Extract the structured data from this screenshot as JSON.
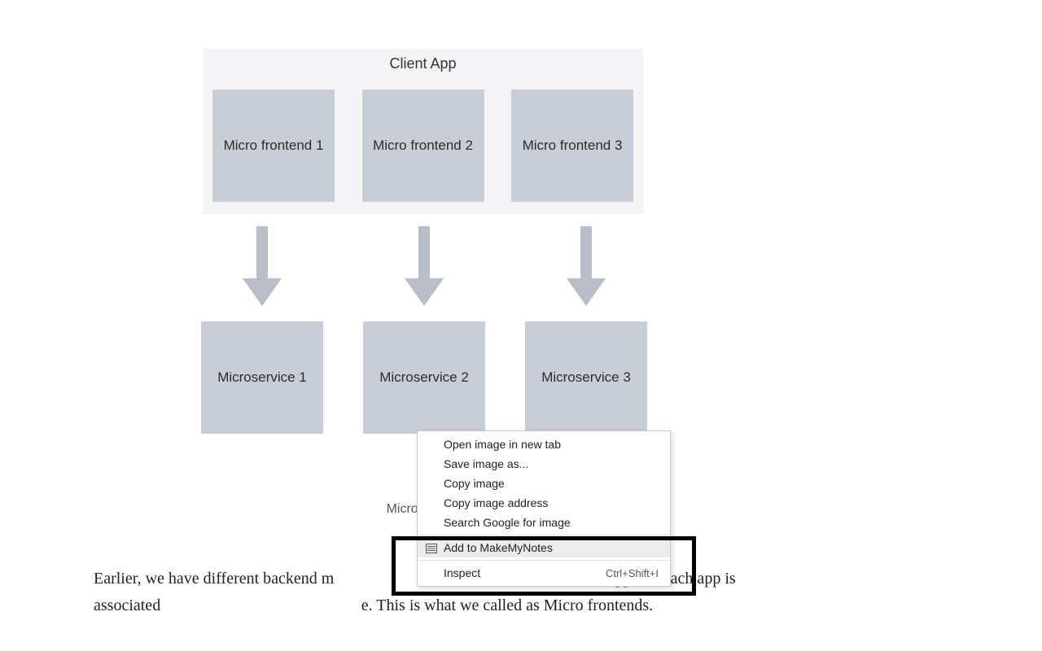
{
  "diagram": {
    "client_app_title": "Client App",
    "frontends": [
      {
        "label": "Micro frontend 1"
      },
      {
        "label": "Micro frontend 2"
      },
      {
        "label": "Micro frontend 3"
      }
    ],
    "services": [
      {
        "label": "Microservice 1"
      },
      {
        "label": "Microservice 2"
      },
      {
        "label": "Microservice 3"
      }
    ],
    "caption": "Micro Fronte"
  },
  "article": {
    "paragraph_pre": "Earlier, we have different backend m",
    "paragraph_mid": "ifferent client app and each app is associated",
    "paragraph_post": "e. This is what we called as Micro frontends."
  },
  "context_menu": {
    "items": [
      {
        "label": "Open image in new tab",
        "shortcut": ""
      },
      {
        "label": "Save image as...",
        "shortcut": ""
      },
      {
        "label": "Copy image",
        "shortcut": ""
      },
      {
        "label": "Copy image address",
        "shortcut": ""
      },
      {
        "label": "Search Google for image",
        "shortcut": ""
      }
    ],
    "highlighted": {
      "label": "Add to MakeMyNotes",
      "shortcut": ""
    },
    "inspect": {
      "label": "Inspect",
      "shortcut": "Ctrl+Shift+I"
    }
  }
}
